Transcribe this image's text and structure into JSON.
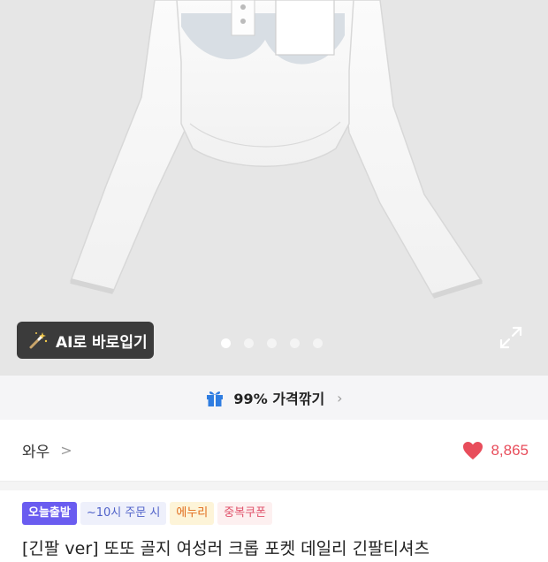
{
  "hero": {
    "ai_button_label": "AI로 바로입기",
    "carousel": {
      "total": 5,
      "active": 1
    }
  },
  "deal_bar": {
    "label": "99% 가격깎기"
  },
  "brand": {
    "name": "와우",
    "chevron": ">"
  },
  "likes": {
    "count": "8,865"
  },
  "badges": [
    "오늘출발",
    "~10시 주문 시",
    "에누리",
    "중복쿠폰"
  ],
  "product": {
    "title": "[긴팔 ver] 또또 골지 여성러 크롭 포켓 데일리 긴팔티셔츠"
  },
  "colors": {
    "heart": "#e84d5b",
    "badge_today": "#6a5cf0",
    "badge_time_text": "#5062c9",
    "badge_discount_text": "#e16b1b",
    "badge_coupon_text": "#e0516a",
    "gift_icon": "#2f7de1"
  },
  "icons": [
    "magic-wand-icon",
    "expand-icon",
    "gift-icon",
    "chevron-right-icon",
    "heart-icon"
  ]
}
